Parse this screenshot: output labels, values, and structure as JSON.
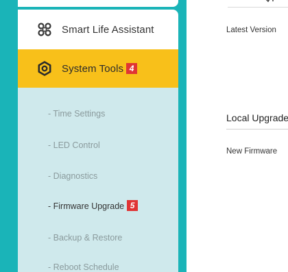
{
  "sidebar": {
    "smart_life": {
      "label": "Smart Life Assistant",
      "icon": "cluster-icon"
    },
    "system_tools": {
      "label": "System Tools",
      "badge": "4",
      "icon": "gear-icon"
    },
    "submenu": [
      {
        "label": "- Time Settings"
      },
      {
        "label": "- LED Control"
      },
      {
        "label": "- Diagnostics"
      },
      {
        "label": "- Firmware Upgrade",
        "badge": "5",
        "active": true
      },
      {
        "label": "- Backup & Restore"
      },
      {
        "label": "- Reboot Schedule"
      }
    ]
  },
  "main": {
    "latest_version_label": "Latest Version",
    "local_upgrade_title": "Local Upgrade",
    "new_firmware_label": "New Firmware"
  },
  "colors": {
    "sidebar_bg": "#1ab4b8",
    "active_item_bg": "#f8c01a",
    "submenu_bg": "#cfe9ec",
    "badge": "#e03434"
  }
}
